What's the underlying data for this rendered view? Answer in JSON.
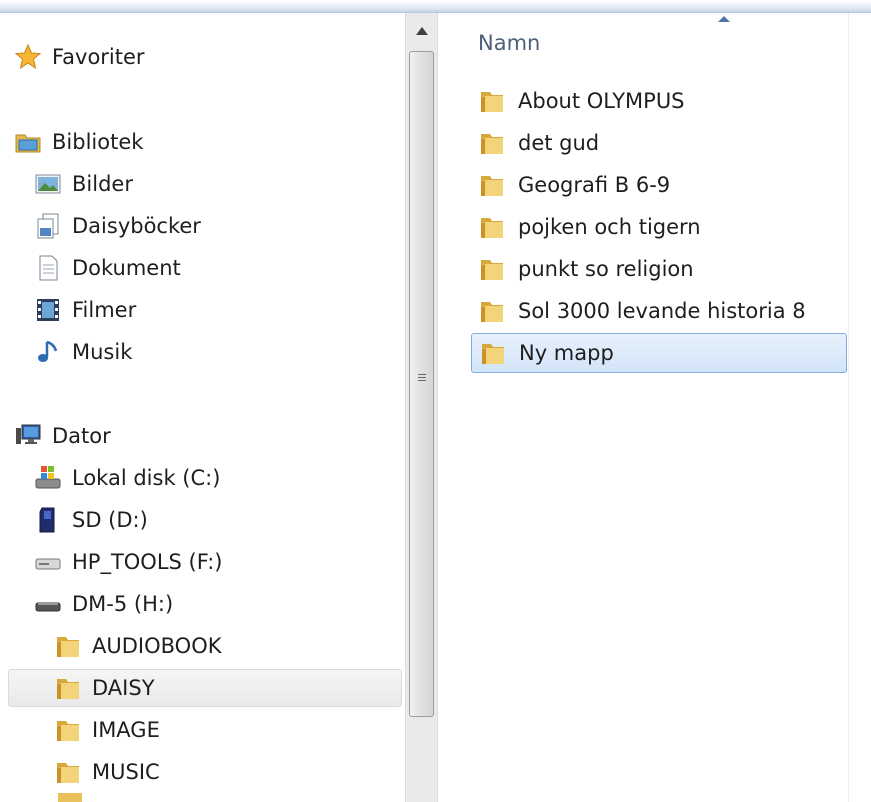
{
  "nav": {
    "items": [
      {
        "label": "Favoriter",
        "icon": "star-icon"
      },
      {
        "label": "Bibliotek",
        "icon": "library-icon"
      },
      {
        "label": "Bilder",
        "icon": "pictures-icon"
      },
      {
        "label": "Daisyböcker",
        "icon": "document-library-icon"
      },
      {
        "label": "Dokument",
        "icon": "document-icon"
      },
      {
        "label": "Filmer",
        "icon": "film-icon"
      },
      {
        "label": "Musik",
        "icon": "music-note-icon"
      },
      {
        "label": "Dator",
        "icon": "computer-icon"
      },
      {
        "label": "Lokal disk (C:)",
        "icon": "system-drive-icon"
      },
      {
        "label": "SD (D:)",
        "icon": "sd-card-icon"
      },
      {
        "label": "HP_TOOLS (F:)",
        "icon": "drive-icon"
      },
      {
        "label": "DM-5 (H:)",
        "icon": "removable-drive-icon"
      },
      {
        "label": "AUDIOBOOK",
        "icon": "folder-icon"
      },
      {
        "label": "DAISY",
        "icon": "folder-icon"
      },
      {
        "label": "IMAGE",
        "icon": "folder-icon"
      },
      {
        "label": "MUSIC",
        "icon": "folder-icon"
      }
    ],
    "selected": "DAISY"
  },
  "content": {
    "column_header": "Namn",
    "sort": "ascending",
    "rows": [
      "About OLYMPUS",
      "det gud",
      "Geografi B 6-9",
      "pojken och tigern",
      "punkt so religion",
      "Sol 3000 levande historia 8",
      "Ny mapp"
    ],
    "selected": "Ny mapp"
  },
  "colors": {
    "folder": "#e8c25a",
    "selection_border": "#84acdd",
    "header_text": "#4c607a"
  }
}
